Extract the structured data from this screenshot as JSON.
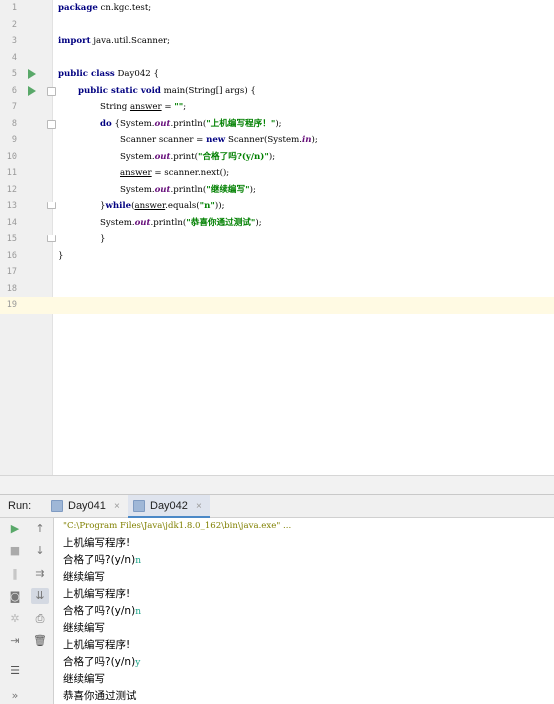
{
  "editor": {
    "lines": [
      {
        "n": "1"
      },
      {
        "n": "2"
      },
      {
        "n": "3"
      },
      {
        "n": "4"
      },
      {
        "n": "5"
      },
      {
        "n": "6"
      },
      {
        "n": "7"
      },
      {
        "n": "8"
      },
      {
        "n": "9"
      },
      {
        "n": "10"
      },
      {
        "n": "11"
      },
      {
        "n": "12"
      },
      {
        "n": "13"
      },
      {
        "n": "14"
      },
      {
        "n": "15"
      },
      {
        "n": "16"
      },
      {
        "n": "17"
      },
      {
        "n": "18"
      },
      {
        "n": "19"
      }
    ],
    "code": {
      "l1_kw": "package",
      "l1_rest": " cn.kgc.test;",
      "l3_kw": "import",
      "l3_rest": " java.util.Scanner;",
      "l5_kw": "public class",
      "l5_rest": " Day042 {",
      "l6_kw": "public static void",
      "l6_rest": " main(String[] args) {",
      "l7_a": "String ",
      "l7_var": "answer",
      "l7_b": " = ",
      "l7_str": "\"\"",
      "l7_c": ";",
      "l8_kw": "do",
      "l8_a": " {System.",
      "l8_fld": "out",
      "l8_b": ".println(",
      "l8_str": "\"上机编写程序！\"",
      "l8_c": ");",
      "l9_a": "Scanner scanner = ",
      "l9_kw": "new",
      "l9_b": " Scanner(System.",
      "l9_fld": "in",
      "l9_c": ");",
      "l10_a": "System.",
      "l10_fld": "out",
      "l10_b": ".print(",
      "l10_str": "\"合格了吗?(y/n)\"",
      "l10_c": ");",
      "l11_var": "answer",
      "l11_a": " = scanner.next();",
      "l12_a": "System.",
      "l12_fld": "out",
      "l12_b": ".println(",
      "l12_str": "\"继续编写\"",
      "l12_c": ");",
      "l13_a": "}",
      "l13_kw": "while",
      "l13_b": "(",
      "l13_var": "answer",
      "l13_c": ".equals(",
      "l13_str": "\"n\"",
      "l13_d": "));",
      "l14_a": "System.",
      "l14_fld": "out",
      "l14_b": ".println(",
      "l14_str": "\"恭喜你通过测试\"",
      "l14_c": ");",
      "l15": "}",
      "l16": "}"
    }
  },
  "run": {
    "label": "Run:",
    "tabs": [
      {
        "label": "Day041",
        "close": "×"
      },
      {
        "label": "Day042",
        "close": "×"
      }
    ]
  },
  "toolbar_icons": [
    "run-icon",
    "up-icon",
    "stop-icon",
    "down-icon",
    "pause-icon",
    "soft-wrap-icon",
    "camera-icon",
    "scroll-to-end-icon",
    "settings-icon",
    "print-icon",
    "login-icon",
    "delete-icon",
    "layout-icon",
    "more-icon"
  ],
  "console": {
    "cmd": "\"C:\\Program Files\\Java\\jdk1.8.0_162\\bin\\java.exe\" ...",
    "out": [
      {
        "text": "上机编写程序!",
        "input": ""
      },
      {
        "text": "合格了吗?(y/n)",
        "input": "n"
      },
      {
        "text": "继续编写",
        "input": ""
      },
      {
        "text": "上机编写程序!",
        "input": ""
      },
      {
        "text": "合格了吗?(y/n)",
        "input": "n"
      },
      {
        "text": "继续编写",
        "input": ""
      },
      {
        "text": "上机编写程序!",
        "input": ""
      },
      {
        "text": "合格了吗?(y/n)",
        "input": "y"
      },
      {
        "text": "继续编写",
        "input": ""
      },
      {
        "text": "恭喜你通过测试",
        "input": ""
      }
    ]
  },
  "colors": {
    "keyword": "#000080",
    "string": "#008000",
    "field": "#660e7a",
    "current_line": "#fffae3",
    "run_green": "#59a869"
  }
}
